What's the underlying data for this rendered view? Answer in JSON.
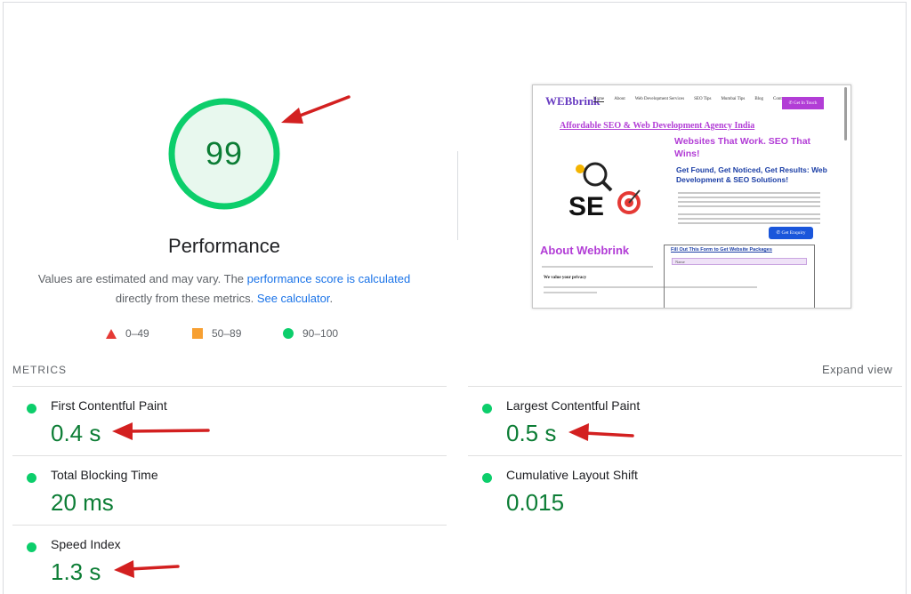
{
  "gauge": {
    "score": "99",
    "title": "Performance",
    "color": "#0cce6b",
    "fill": "#e8f8ee"
  },
  "description": {
    "text1": "Values are estimated and may vary. The ",
    "link1": "performance score is calculated",
    "text2": " directly from these metrics. ",
    "link2": "See calculator",
    "text3": "."
  },
  "legend": [
    {
      "icon": "triangle-icon",
      "range": "0–49",
      "color": "#e53935"
    },
    {
      "icon": "square-icon",
      "range": "50–89",
      "color": "#f7a032"
    },
    {
      "icon": "circle-icon",
      "range": "90–100",
      "color": "#0cce6b"
    }
  ],
  "screenshot": {
    "logo": "WEBbrink",
    "nav": [
      "Home",
      "About",
      "Web Development Services",
      "SEO Tips",
      "Mumbai Tips",
      "Blog",
      "Contact"
    ],
    "cta": "✆ Get In Touch",
    "headline": "Affordable SEO & Web Development Agency India",
    "hero_title": "Websites That Work. SEO That Wins!",
    "hero_sub": "Get Found, Get Noticed, Get Results: Web Development & SEO Solutions!",
    "enquiry": "✆ Get Enquiry",
    "about": "About Webbrink",
    "form_title": "Fill Out This Form to Get Website Packages",
    "form_field": "Name",
    "privacy": "We value your privacy"
  },
  "metrics": {
    "section_label": "METRICS",
    "expand_label": "Expand view",
    "items": [
      {
        "label": "First Contentful Paint",
        "value": "0.4 s"
      },
      {
        "label": "Largest Contentful Paint",
        "value": "0.5 s"
      },
      {
        "label": "Total Blocking Time",
        "value": "20 ms"
      },
      {
        "label": "Cumulative Layout Shift",
        "value": "0.015"
      },
      {
        "label": "Speed Index",
        "value": "1.3 s"
      }
    ]
  },
  "annotation_color": "#d32020"
}
